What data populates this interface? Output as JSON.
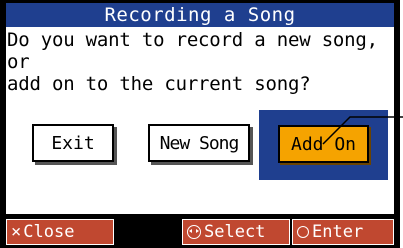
{
  "dialog": {
    "title": "Recording a Song",
    "prompt": "Do you want to record a new song, or\nadd on to the current song?"
  },
  "buttons": {
    "exit_label": "Exit",
    "new_song_label": "New Song",
    "add_on_label": "Add On"
  },
  "softkeys": {
    "close_label": "Close",
    "select_label": "Select",
    "enter_label": "Enter"
  },
  "icons": {
    "close": "x-mark-icon",
    "select": "select-dial-icon",
    "enter": "circle-icon"
  },
  "colors": {
    "title_bar": "#1f3f8f",
    "selected_frame": "#1f3f8f",
    "selected_button": "#f5a300",
    "softkey": "#c04830"
  }
}
